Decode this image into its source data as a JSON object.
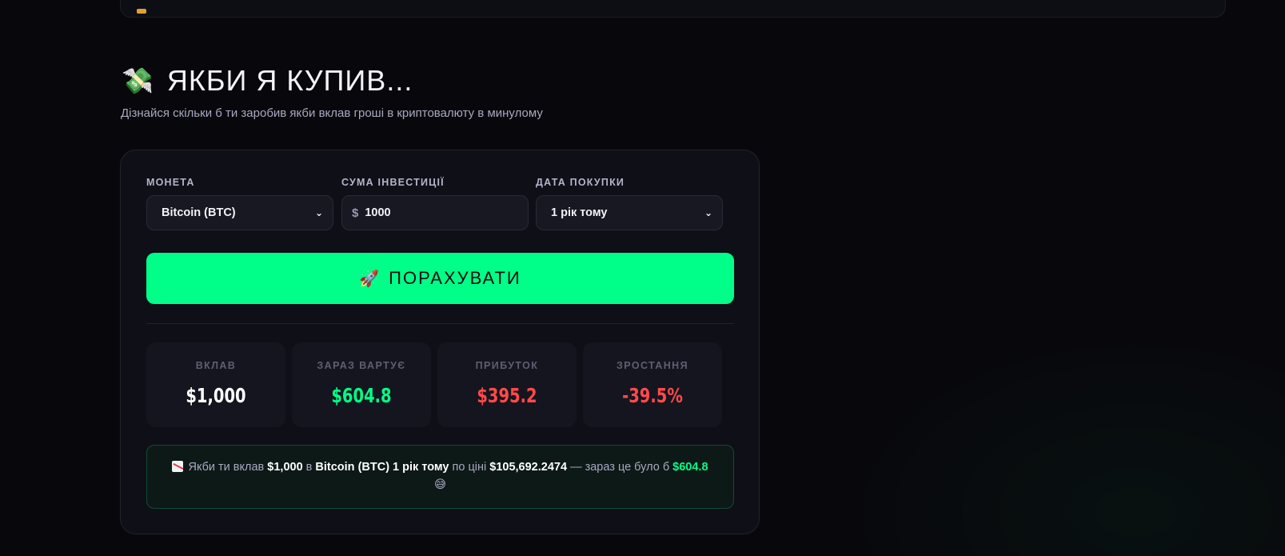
{
  "section": {
    "emoji": "💸",
    "title": "ЯКБИ Я КУПИВ...",
    "subtitle": "Дізнайся скільки б ти заробив якби вклав гроші в криптовалюту в минулому"
  },
  "form": {
    "coin": {
      "label": "МОНЕТА",
      "selected": "Bitcoin (BTC)"
    },
    "amount": {
      "label": "СУМА ІНВЕСТИЦІЇ",
      "currency": "$",
      "value": "1000"
    },
    "date": {
      "label": "ДАТА ПОКУПКИ",
      "selected": "1 рік тому"
    },
    "button": {
      "emoji": "🚀",
      "label": "ПОРАХУВАТИ"
    }
  },
  "stats": [
    {
      "label": "ВКЛАВ",
      "value": "$1,000",
      "color": "#ffffff"
    },
    {
      "label": "ЗАРАЗ ВАРТУЄ",
      "value": "$604.8",
      "color": "#00ff88"
    },
    {
      "label": "ПРИБУТОК",
      "value": "$395.2",
      "color": "#ff4a4a"
    },
    {
      "label": "ЗРОСТАННЯ",
      "value": "-39.5%",
      "color": "#ff4a4a"
    }
  ],
  "result": {
    "icon": "chart-decreasing-icon",
    "p1": "Якби ти вклав",
    "amount": "$1,000",
    "p2": "в",
    "coin_period": "Bitcoin (BTC) 1 рік тому",
    "p3": "по ціні",
    "price": "$105,692.2474",
    "p4": "— зараз це було б",
    "now_value": "$604.8",
    "emoji": "😅"
  },
  "colors": {
    "accent": "#00ff88",
    "loss": "#ff4a4a",
    "background": "#08080c",
    "panel": "#0f0f17"
  }
}
